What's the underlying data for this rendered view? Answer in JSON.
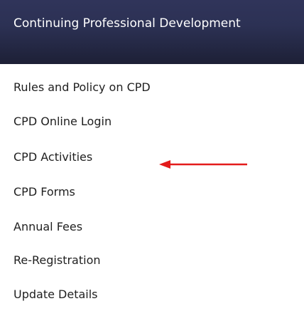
{
  "header": {
    "title": "Continuing Professional Development"
  },
  "menu": {
    "items": [
      {
        "label": "Rules and Policy on CPD"
      },
      {
        "label": "CPD Online Login"
      },
      {
        "label": "CPD Activities"
      },
      {
        "label": "CPD Forms"
      },
      {
        "label": "Annual Fees"
      },
      {
        "label": "Re-Registration"
      },
      {
        "label": "Update Details"
      }
    ]
  },
  "annotation": {
    "arrow_color": "#e31b1b",
    "arrow_icon": "left-arrow-icon"
  }
}
